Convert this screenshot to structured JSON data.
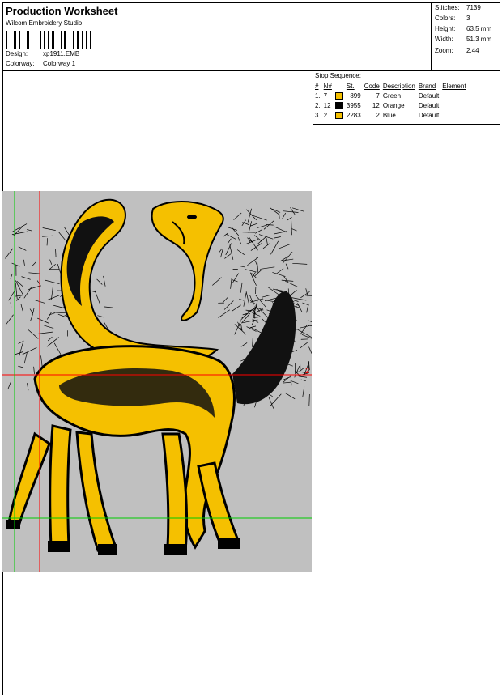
{
  "header": {
    "title": "Production Worksheet",
    "software": "Wilcom  Embroidery Studio",
    "design_label": "Design:",
    "design_value": "xp1911.EMB",
    "colorway_label": "Colorway:",
    "colorway_value": "Colorway  1"
  },
  "stats": [
    {
      "label": "Stitches:",
      "value": "7139"
    },
    {
      "label": "Colors:",
      "value": "3"
    },
    {
      "label": "Height:",
      "value": "63.5 mm"
    },
    {
      "label": "Width:",
      "value": "51.3 mm"
    },
    {
      "label": "Zoom:",
      "value": "2.44"
    }
  ],
  "stop_sequence": {
    "title": "Stop Sequence:",
    "columns": [
      "#",
      "N#",
      "St.",
      "Code",
      "Description",
      "Brand",
      "Element"
    ],
    "rows": [
      {
        "index": "1.",
        "n": "7",
        "swatch": "#f5c000",
        "st": "899",
        "code": "7",
        "description": "Green",
        "brand": "Default",
        "element": ""
      },
      {
        "index": "2.",
        "n": "12",
        "swatch": "#000000",
        "st": "3955",
        "code": "12",
        "description": "Orange",
        "brand": "Default",
        "element": ""
      },
      {
        "index": "3.",
        "n": "2",
        "swatch": "#f5c000",
        "st": "2283",
        "code": "2",
        "description": "Blue",
        "brand": "Default",
        "element": ""
      }
    ]
  },
  "canvas": {
    "background": "#c0c0c0",
    "thread_colors": [
      "#f5c000",
      "#000000"
    ],
    "marker_label": "2"
  }
}
